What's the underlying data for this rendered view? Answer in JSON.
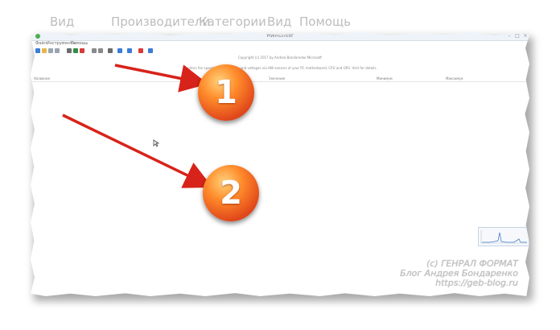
{
  "background_menu": [
    "Вид",
    "Производители",
    "Категории",
    "Вид",
    "Помощь"
  ],
  "window": {
    "title": "HWMonitor",
    "menu": [
      "Файл",
      "Инструменты",
      "Помощь"
    ],
    "info_line_1": "Copyright (c) 2017 by Andrea Bondarenko Microsoft",
    "info_line_2": "Monitors fan speeds, temperatures and voltages via HW sensors of your PC motherboard, CPU and GPU. Visit for details."
  },
  "list_header": [
    "Название",
    "Значение",
    "Минимум",
    "Максимум"
  ],
  "toolbar_icons": [
    {
      "name": "refresh-icon",
      "color": "#3b7dd8"
    },
    {
      "name": "folder-icon",
      "color": "#e8b64a"
    },
    {
      "name": "copy-icon",
      "color": "#9aa4b2"
    },
    {
      "name": "cut-icon",
      "color": "#9aa4b2"
    },
    {
      "name": "grid-icon",
      "color": "#6d6d6d"
    },
    {
      "name": "chart-icon",
      "color": "#2f8f46"
    },
    {
      "name": "stop-icon",
      "color": "#d83a3a"
    },
    {
      "name": "gear-icon",
      "color": "#8a8a8a"
    },
    {
      "name": "page-icon",
      "color": "#8a8a8a"
    },
    {
      "name": "bell-icon",
      "color": "#6b6b6b"
    },
    {
      "name": "globe-icon",
      "color": "#3b7dd8"
    },
    {
      "name": "help-icon",
      "color": "#3b7dd8"
    },
    {
      "name": "heart-icon",
      "color": "#d83a3a"
    },
    {
      "name": "info-icon",
      "color": "#3b7dd8"
    }
  ],
  "annotations": [
    {
      "label": "1",
      "color": "#e0461a"
    },
    {
      "label": "2",
      "color": "#e0461a"
    }
  ],
  "watermark": [
    "(c) ГЕНРАЛ ФОРМАТ",
    "Блог Андрея Бондаренко",
    "https://geb-blog.ru"
  ]
}
